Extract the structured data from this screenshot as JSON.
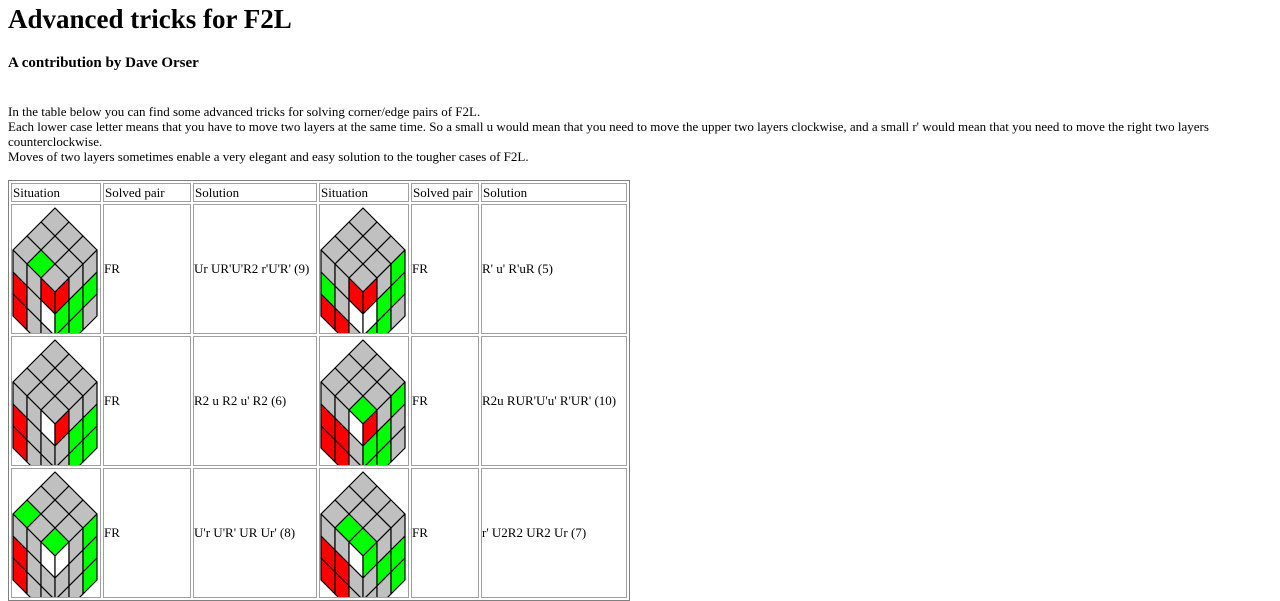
{
  "page": {
    "title": "Advanced tricks for F2L",
    "subtitle": "A contribution by Dave Orser",
    "intro": [
      "In the table below you can find some advanced tricks for solving corner/edge pairs of F2L.",
      "Each lower case letter means that you have to move two layers at the same time. So a small u would mean that you need to move the upper two layers clockwise, and a small r' would mean that you need to move the right two layers counterclockwise.",
      "Moves of two layers sometimes enable a very elegant and easy solution to the tougher cases of F2L."
    ]
  },
  "colors": {
    "gray": "#c0c0c0",
    "red": "#ff0000",
    "green": "#00ff00",
    "white": "#ffffff"
  },
  "table": {
    "headers": [
      "Situation",
      "Solved pair",
      "Solution",
      "Situation",
      "Solved pair",
      "Solution"
    ],
    "rows": [
      [
        {
          "pair": "FR",
          "solution": "Ur UR'U'R2 r'U'R' (9)",
          "top": [
            "g",
            "g",
            "g",
            "g",
            "g",
            "G",
            "g",
            "g",
            "g"
          ],
          "left": [
            "g",
            "g",
            "R",
            "R",
            "g",
            "W",
            "R",
            "g",
            "g"
          ],
          "right": [
            "R",
            "g",
            "g",
            "G",
            "G",
            "G",
            "G",
            "G",
            "g"
          ]
        },
        {
          "pair": "FR",
          "solution": "R' u' R'uR (5)",
          "top": [
            "g",
            "g",
            "g",
            "g",
            "g",
            "g",
            "g",
            "g",
            "g"
          ],
          "left": [
            "g",
            "g",
            "R",
            "G",
            "g",
            "W",
            "R",
            "R",
            "g"
          ],
          "right": [
            "R",
            "g",
            "G",
            "W",
            "G",
            "G",
            "G",
            "G",
            "g"
          ]
        }
      ],
      [
        {
          "pair": "FR",
          "solution": "R2 u R2 u' R2 (6)",
          "top": [
            "g",
            "g",
            "g",
            "g",
            "g",
            "g",
            "g",
            "g",
            "g"
          ],
          "left": [
            "g",
            "g",
            "W",
            "R",
            "g",
            "g",
            "R",
            "g",
            "g"
          ],
          "right": [
            "R",
            "g",
            "g",
            "g",
            "G",
            "G",
            "g",
            "G",
            "G"
          ]
        },
        {
          "pair": "FR",
          "solution": "R2u RUR'U'u' R'UR' (10)",
          "top": [
            "g",
            "g",
            "g",
            "g",
            "g",
            "g",
            "g",
            "g",
            "G"
          ],
          "left": [
            "g",
            "g",
            "W",
            "R",
            "R",
            "g",
            "R",
            "R",
            "g"
          ],
          "right": [
            "R",
            "g",
            "G",
            "G",
            "G",
            "g",
            "G",
            "G",
            "g"
          ]
        }
      ],
      [
        {
          "pair": "FR",
          "solution": "U'r U'R' UR Ur' (8)",
          "top": [
            "g",
            "g",
            "G",
            "g",
            "g",
            "g",
            "g",
            "g",
            "G"
          ],
          "left": [
            "g",
            "g",
            "W",
            "R",
            "g",
            "g",
            "R",
            "g",
            "g"
          ],
          "right": [
            "W",
            "g",
            "G",
            "g",
            "g",
            "G",
            "g",
            "g",
            "G"
          ]
        },
        {
          "pair": "FR",
          "solution": "r' U2R2 UR2 Ur (7)",
          "top": [
            "g",
            "g",
            "g",
            "g",
            "g",
            "G",
            "g",
            "g",
            "G"
          ],
          "left": [
            "g",
            "g",
            "W",
            "R",
            "R",
            "g",
            "R",
            "R",
            "g"
          ],
          "right": [
            "G",
            "g",
            "g",
            "g",
            "G",
            "G",
            "g",
            "g",
            "G"
          ]
        }
      ]
    ]
  }
}
